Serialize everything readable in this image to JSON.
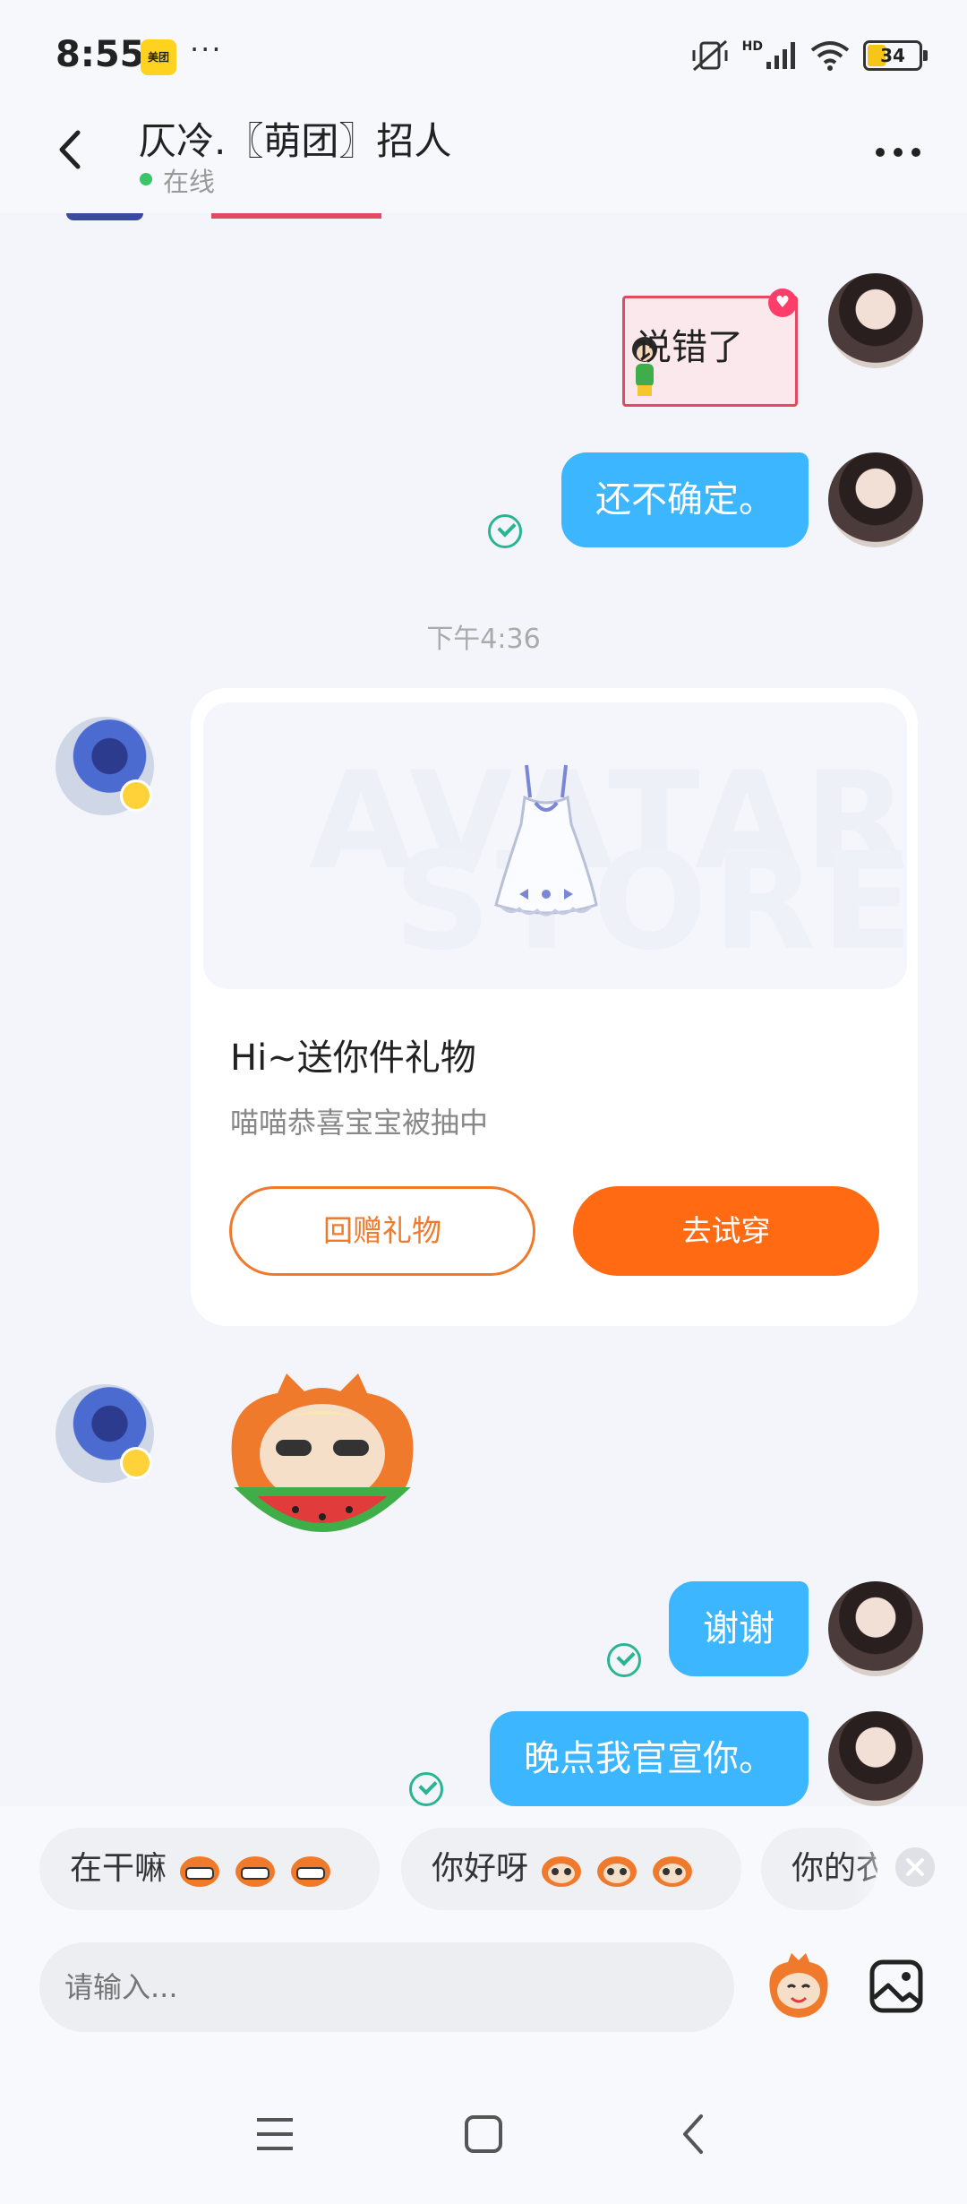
{
  "status_bar": {
    "time": "8:55",
    "meituan_label": "美团",
    "more": "···",
    "hd_label": "HD",
    "battery": "34"
  },
  "header": {
    "title": "仄冷.〖萌团〗招人",
    "status": "在线"
  },
  "messages": {
    "sticker_text": "说错了",
    "msg1": "还不确定。",
    "timestamp": "下午4:36",
    "gift_card": {
      "watermark_line1": "AVATAR",
      "watermark_line2": "STORE",
      "title": "Hi~送你件礼物",
      "subtitle": "喵喵恭喜宝宝被抽中",
      "return_button": "回赠礼物",
      "try_button": "去试穿"
    },
    "msg2": "谢谢",
    "msg3": "晚点我官宣你。"
  },
  "quick_replies": [
    {
      "text": "在干嘛"
    },
    {
      "text": "你好呀"
    },
    {
      "text": "你的衣"
    }
  ],
  "input": {
    "placeholder": "请输入..."
  },
  "colors": {
    "bubble_blue": "#3bb6ff",
    "accent_orange": "#ff6a12",
    "online_green": "#3ac569",
    "read_check": "#2ab592"
  }
}
